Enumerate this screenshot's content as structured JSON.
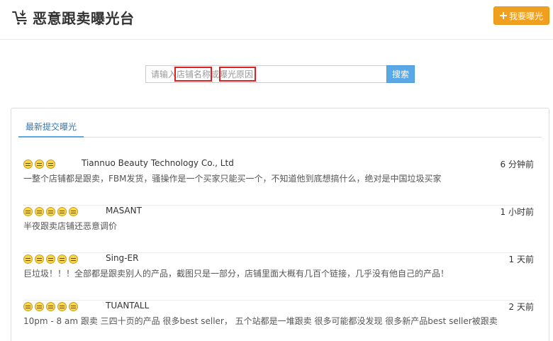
{
  "header": {
    "title": "恶意跟卖曝光台",
    "logo_icon": "cart-icon",
    "expose_button_label": "我要曝光"
  },
  "search": {
    "placeholder": "请输入店铺名称或曝光原因",
    "button_label": "搜索"
  },
  "tabs": [
    {
      "label": "最新提交曝光",
      "active": true
    }
  ],
  "reports": [
    {
      "rating": 3,
      "shop": "Tiannuo Beauty Technology Co., Ltd",
      "time": "6 分钟前",
      "description": "一整个店铺都是跟卖，FBM发货，骚操作是一个买家只能买一个，不知道他到底想搞什么，绝对是中国垃圾买家"
    },
    {
      "rating": 5,
      "shop": "MASANT",
      "time": "1 小时前",
      "description": "半夜跟卖店铺还恶意调价"
    },
    {
      "rating": 5,
      "shop": "Sing-ER",
      "time": "1 天前",
      "description": "巨垃圾！！！全部都是跟卖别人的产品，截图只是一部分，店铺里面大概有几百个链接，几乎没有他自己的产品！"
    },
    {
      "rating": 5,
      "shop": "TUANTALL",
      "time": "2 天前",
      "description": "10pm - 8 am 跟卖 三四十页的产品 很多best seller， 五个站都是一堆跟卖 很多可能都没发现 很多新产品best seller被跟卖"
    }
  ],
  "colors": {
    "accent_orange": "#f0a01e",
    "accent_blue": "#5aa9e6",
    "highlight_red": "#e02020"
  }
}
